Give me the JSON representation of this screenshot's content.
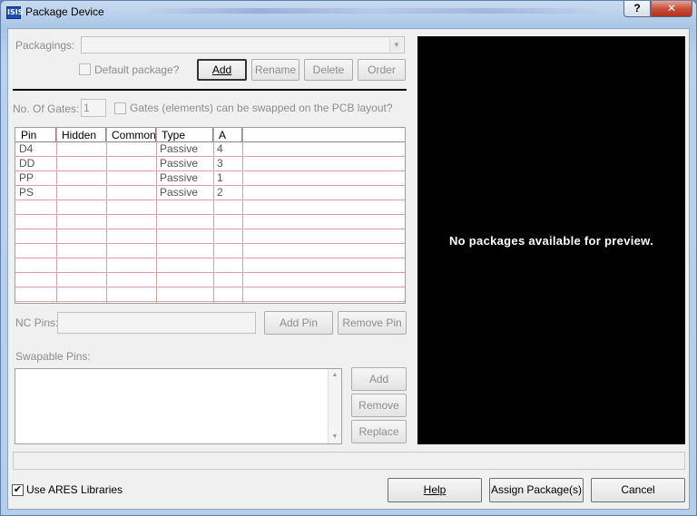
{
  "window": {
    "title": "Package Device",
    "icon_text": "ISIS",
    "help_glyph": "?",
    "close_glyph": "✕"
  },
  "packagings": {
    "label": "Packagings:",
    "value": "",
    "arrow_glyph": "▼",
    "default_package_label": "Default package?",
    "default_package_checked": false
  },
  "package_buttons": {
    "add": "Add",
    "rename": "Rename",
    "delete": "Delete",
    "order": "Order"
  },
  "gates": {
    "label": "No. Of Gates:",
    "value": "1",
    "swap_label": "Gates (elements) can be swapped on the PCB layout?",
    "swap_checked": false
  },
  "pin_table": {
    "columns": [
      "Pin",
      "Hidden",
      "Common",
      "Type",
      "A"
    ],
    "rows": [
      {
        "pin": "D4",
        "hidden": "",
        "common": "",
        "type": "Passive",
        "a": "4"
      },
      {
        "pin": "DD",
        "hidden": "",
        "common": "",
        "type": "Passive",
        "a": "3"
      },
      {
        "pin": "PP",
        "hidden": "",
        "common": "",
        "type": "Passive",
        "a": "1"
      },
      {
        "pin": "PS",
        "hidden": "",
        "common": "",
        "type": "Passive",
        "a": "2"
      }
    ]
  },
  "nc_pins": {
    "label": "NC Pins:",
    "value": "",
    "add_pin": "Add Pin",
    "remove_pin": "Remove Pin"
  },
  "swapable": {
    "label": "Swapable Pins:",
    "add": "Add",
    "remove": "Remove",
    "replace": "Replace",
    "scroll_up_glyph": "▲",
    "scroll_down_glyph": "▼"
  },
  "preview": {
    "message": "No packages available for preview."
  },
  "footer": {
    "use_ares_label": "Use ARES Libraries",
    "use_ares_checked": true,
    "check_glyph": "✔",
    "help": "Help",
    "assign": "Assign Package(s)",
    "cancel": "Cancel"
  }
}
